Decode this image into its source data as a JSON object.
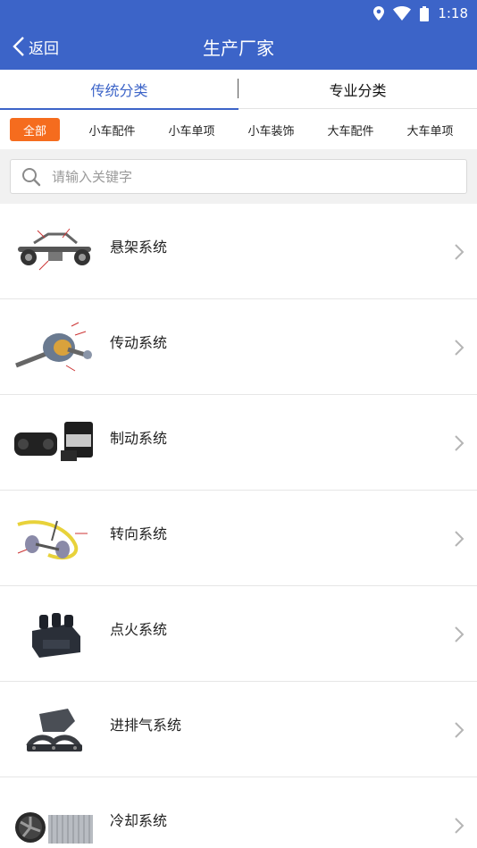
{
  "status_bar": {
    "time": "1:18",
    "icons": [
      "location-icon",
      "wifi-icon",
      "battery-icon"
    ]
  },
  "header": {
    "back_label": "返回",
    "title": "生产厂家"
  },
  "tabs": [
    {
      "label": "传统分类",
      "active": true
    },
    {
      "label": "专业分类",
      "active": false
    }
  ],
  "categories": [
    {
      "label": "全部",
      "active": true
    },
    {
      "label": "小车配件"
    },
    {
      "label": "小车单项"
    },
    {
      "label": "小车装饰"
    },
    {
      "label": "大车配件"
    },
    {
      "label": "大车单项"
    }
  ],
  "search": {
    "placeholder": "请输入关键字"
  },
  "systems": [
    {
      "label": "悬架系统",
      "icon": "suspension-part-icon"
    },
    {
      "label": "传动系统",
      "icon": "transmission-part-icon"
    },
    {
      "label": "制动系统",
      "icon": "brake-part-icon"
    },
    {
      "label": "转向系统",
      "icon": "steering-part-icon"
    },
    {
      "label": "点火系统",
      "icon": "ignition-coil-icon"
    },
    {
      "label": "进排气系统",
      "icon": "exhaust-manifold-icon"
    },
    {
      "label": "冷却系统",
      "icon": "radiator-fan-icon"
    }
  ],
  "colors": {
    "primary": "#3c64c8",
    "accent": "#f56c1e"
  }
}
